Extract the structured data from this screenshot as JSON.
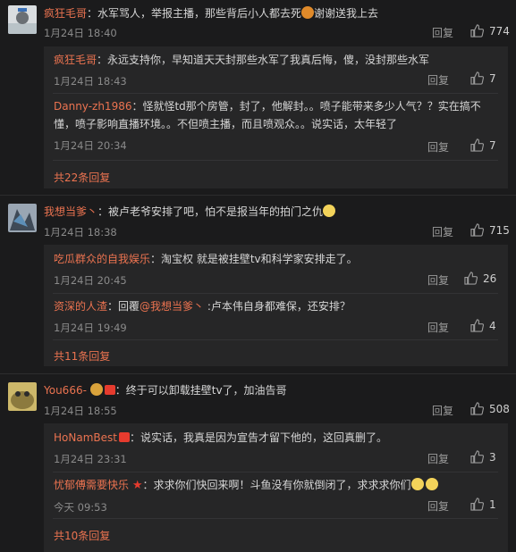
{
  "comments": [
    {
      "user": "疯狂毛哥",
      "text_a": "：水军骂人，举报主播，那些背后小人都去死",
      "text_b": "谢谢送我上去",
      "date": "1月24日 18:40",
      "reply_label": "回复",
      "likes": "774",
      "subs": [
        {
          "user": "疯狂毛哥",
          "text": "：永远支持你，早知道天天封那些水军了我真后悔，傻，没封那些水军",
          "date": "1月24日 18:43",
          "reply_label": "回复",
          "likes": "7"
        },
        {
          "user": "Danny-zh1986",
          "text": "：怪就怪td那个房管，封了，他解封。。喷子能带来多少人气？？实在搞不",
          "text2": "懂，喷子影响直播环境。。不但喷主播，而且喷观众。。说实话，太年轻了",
          "date": "1月24日 20:34",
          "reply_label": "回复",
          "likes": "7"
        }
      ],
      "more": "共22条回复"
    },
    {
      "user": "我想当爹丶",
      "text_a": "：被卢老爷安排了吧，怕不是报当年的拍门之仇",
      "date": "1月24日 18:38",
      "reply_label": "回复",
      "likes": "715",
      "subs": [
        {
          "user": "吃瓜群众的自我娱乐",
          "text": "：淘宝权 就是被挂壁tv和科学家安排走了。",
          "date": "1月24日 20:45",
          "reply_label": "回复",
          "likes": "26"
        },
        {
          "user": "资深的人渣",
          "text_pre": "：回覆",
          "mention": "@我想当爹丶",
          "text": " :卢本伟自身都难保，还安排？",
          "date": "1月24日 19:49",
          "reply_label": "回复",
          "likes": "4"
        }
      ],
      "more": "共11条回复"
    },
    {
      "user": "You666-",
      "text_a": "：终于可以卸载挂壁tv了，加油告哥",
      "date": "1月24日 18:55",
      "reply_label": "回复",
      "likes": "508",
      "subs": [
        {
          "user": "HoNamBest",
          "text": "：说实话，我真是因为宣告才留下他的，这回真删了。",
          "date": "1月24日 23:31",
          "reply_label": "回复",
          "likes": "3"
        },
        {
          "user": "忧郁傅需要快乐",
          "text": "：求求你们快回来啊！斗鱼没有你就倒闭了，求求求你们",
          "date": "今天 09:53",
          "reply_label": "回复",
          "likes": "1"
        }
      ],
      "more": "共10条回复"
    }
  ],
  "colors": {
    "username": "#eb7350",
    "background": "#1b1b1c",
    "box": "#262627"
  }
}
